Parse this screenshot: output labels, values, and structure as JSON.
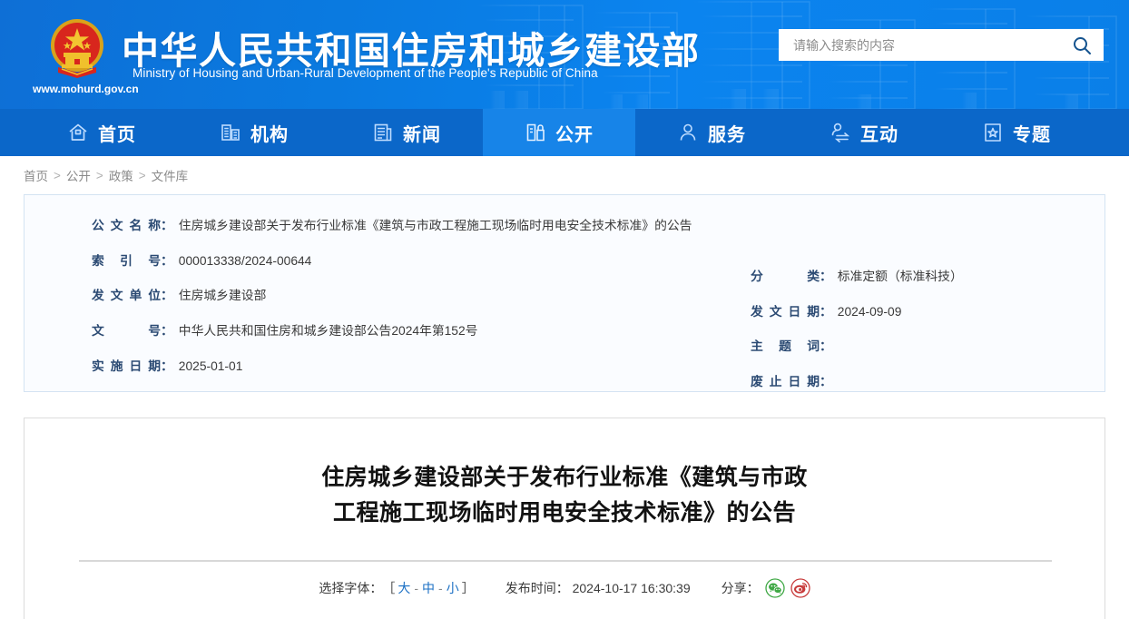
{
  "header": {
    "emblem_icon": "china-national-emblem-icon",
    "title": "中华人民共和国住房和城乡建设部",
    "subtitle": "Ministry of Housing and Urban-Rural Development of the People's Republic of China",
    "url": "www.mohurd.gov.cn",
    "search": {
      "placeholder": "请输入搜索的内容",
      "value": "",
      "button_icon": "search-icon"
    },
    "background_color": "#0a7ae0"
  },
  "nav": {
    "active_index": 3,
    "background_color": "#0b67c9",
    "active_color": "#1784e8",
    "items": [
      {
        "label": "首页",
        "icon": "home-icon"
      },
      {
        "label": "机构",
        "icon": "building-icon"
      },
      {
        "label": "新闻",
        "icon": "news-document-icon"
      },
      {
        "label": "公开",
        "icon": "open-disclosure-icon"
      },
      {
        "label": "服务",
        "icon": "service-person-icon"
      },
      {
        "label": "互动",
        "icon": "interaction-person-icon"
      },
      {
        "label": "专题",
        "icon": "star-topic-icon"
      }
    ]
  },
  "breadcrumb": {
    "separator": ">",
    "items": [
      "首页",
      "公开",
      "政策",
      "文件库"
    ]
  },
  "info_card": {
    "left_rows": [
      {
        "label": "公文名称",
        "value": "住房城乡建设部关于发布行业标准《建筑与市政工程施工现场临时用电安全技术标准》的公告"
      },
      {
        "label": "索引号",
        "value": "000013338/2024-00644"
      },
      {
        "label": "发文单位",
        "value": "住房城乡建设部"
      },
      {
        "label": "文号",
        "value": "中华人民共和国住房和城乡建设部公告2024年第152号"
      },
      {
        "label": "实施日期",
        "value": "2025-01-01"
      }
    ],
    "right_rows": [
      {
        "label": "分类",
        "value": "标准定额（标准科技）"
      },
      {
        "label": "发文日期",
        "value": "2024-09-09"
      },
      {
        "label": "主题词",
        "value": ""
      },
      {
        "label": "废止日期",
        "value": ""
      }
    ],
    "background_color": "#fafcff",
    "border_color": "#d4e3f2"
  },
  "article": {
    "title_line1": "住房城乡建设部关于发布行业标准《建筑与市政",
    "title_line2": "工程施工现场临时用电安全技术标准》的公告",
    "toolbar": {
      "font_label": "选择字体：",
      "bracket_open": "［",
      "bracket_close": "］",
      "size_large": "大",
      "size_medium": "中",
      "size_small": "小",
      "dash": "-",
      "publish_label": "发布时间：",
      "publish_time": "2024-10-17 16:30:39",
      "share_label": "分享：",
      "share_icons": [
        {
          "name": "wechat-share-icon",
          "color": "#3fa845"
        },
        {
          "name": "weibo-share-icon",
          "color": "#c73a3a"
        }
      ]
    }
  }
}
